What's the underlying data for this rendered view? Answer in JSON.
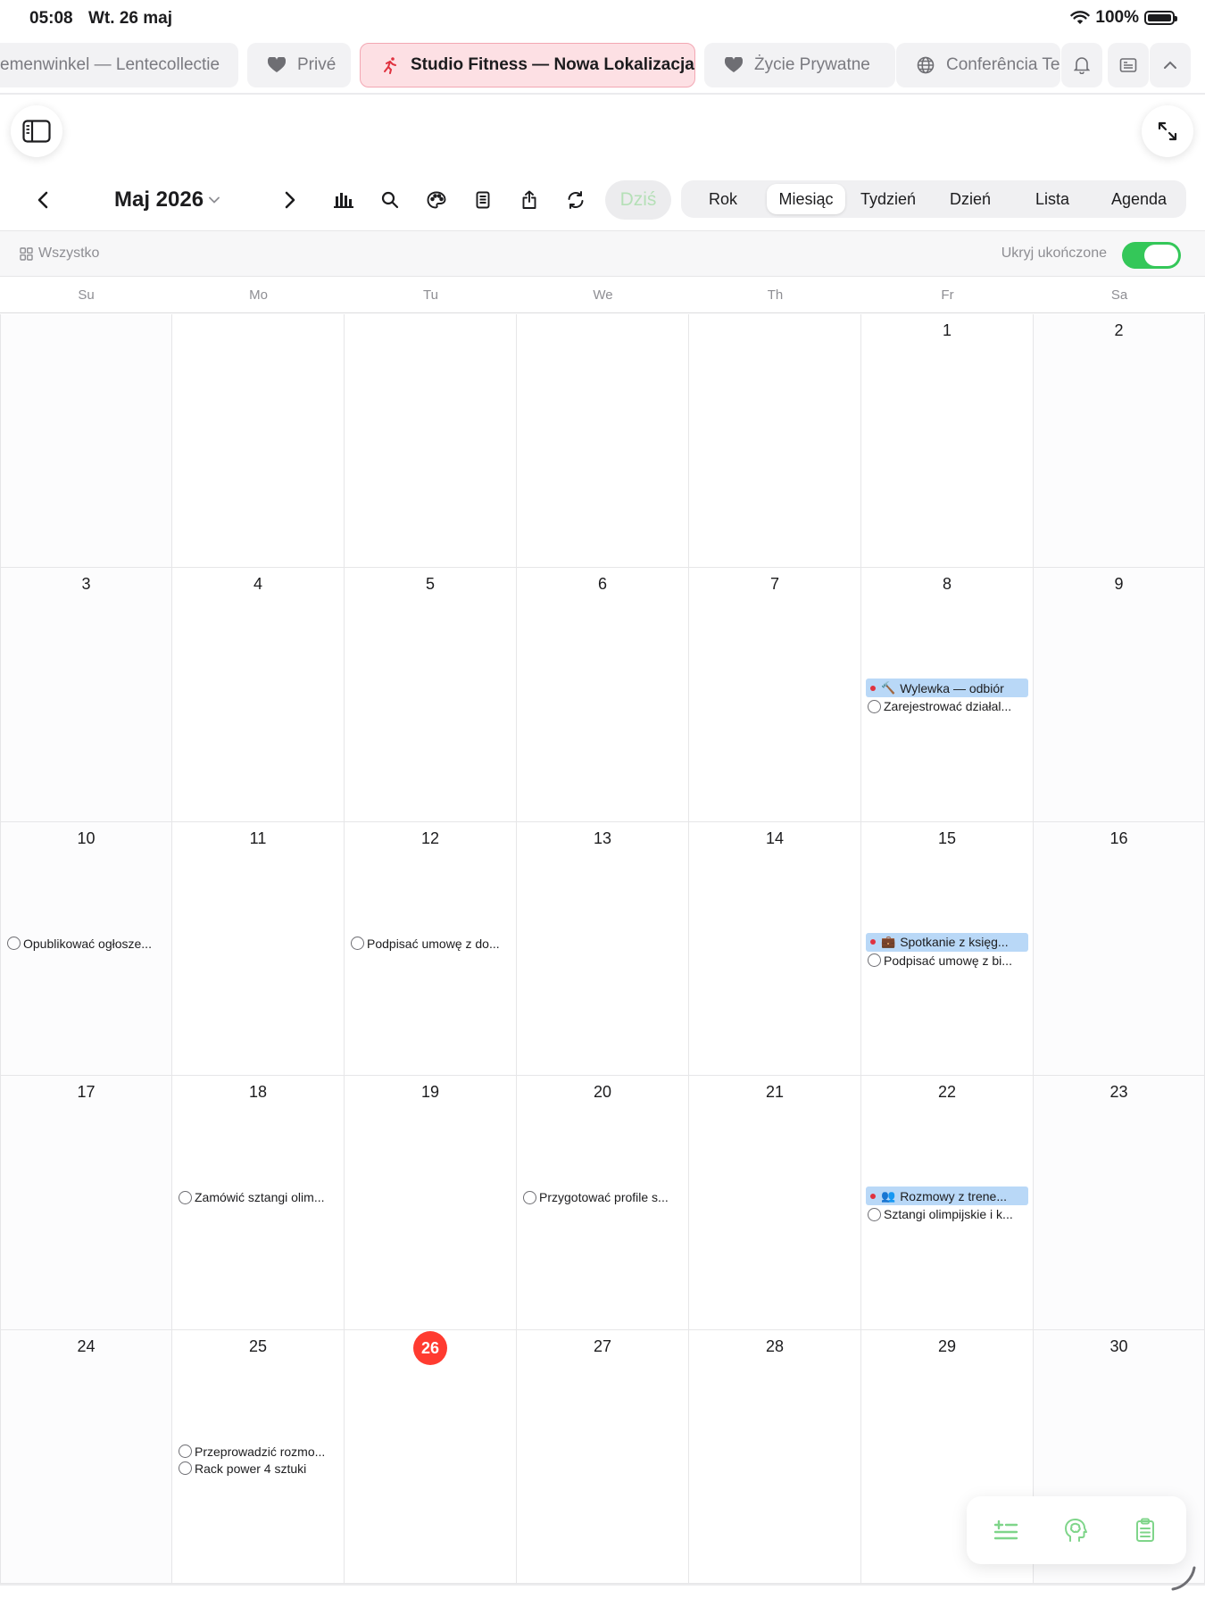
{
  "status": {
    "time": "05:08",
    "date": "Wt. 26 maj",
    "battery": "100%"
  },
  "tabs": [
    {
      "label": "emenwinkel — Lentecollectie",
      "icon": "none"
    },
    {
      "label": "Privé",
      "icon": "heart-icon"
    },
    {
      "label": "Studio Fitness — Nowa Lokalizacja",
      "icon": "runner-icon",
      "active": true
    },
    {
      "label": "Życie Prywatne",
      "icon": "heart-icon"
    },
    {
      "label": "Conferência Te",
      "icon": "globe-icon"
    }
  ],
  "toolbar": {
    "month_title": "Maj 2026",
    "today_label": "Dziś",
    "views": [
      "Rok",
      "Miesiąc",
      "Tydzień",
      "Dzień",
      "Lista",
      "Agenda"
    ],
    "selected_view": "Miesiąc"
  },
  "filter": {
    "all_label": "Wszystko",
    "hide_completed_label": "Ukryj ukończone",
    "hide_completed_on": true
  },
  "weekdays": [
    "Su",
    "Mo",
    "Tu",
    "We",
    "Th",
    "Fr",
    "Sa"
  ],
  "weeks": [
    [
      {
        "day": ""
      },
      {
        "day": ""
      },
      {
        "day": ""
      },
      {
        "day": ""
      },
      {
        "day": ""
      },
      {
        "day": "1"
      },
      {
        "day": "2"
      }
    ],
    [
      {
        "day": "3"
      },
      {
        "day": "4"
      },
      {
        "day": "5"
      },
      {
        "day": "6"
      },
      {
        "day": "7"
      },
      {
        "day": "8",
        "items": [
          {
            "kind": "event",
            "emoji": "🔨",
            "text": "Wylewka — odbiór"
          },
          {
            "kind": "task",
            "text": "Zarejestrować działal..."
          }
        ]
      },
      {
        "day": "9"
      }
    ],
    [
      {
        "day": "10",
        "items": [
          {
            "kind": "task",
            "text": "Opublikować ogłosze..."
          }
        ]
      },
      {
        "day": "11"
      },
      {
        "day": "12",
        "items": [
          {
            "kind": "task",
            "text": "Podpisać umowę z do..."
          }
        ]
      },
      {
        "day": "13"
      },
      {
        "day": "14"
      },
      {
        "day": "15",
        "items": [
          {
            "kind": "event",
            "emoji": "💼",
            "text": "Spotkanie z księg..."
          },
          {
            "kind": "task",
            "text": "Podpisać umowę z bi..."
          }
        ]
      },
      {
        "day": "16"
      }
    ],
    [
      {
        "day": "17"
      },
      {
        "day": "18",
        "items": [
          {
            "kind": "task",
            "text": "Zamówić sztangi olim..."
          }
        ]
      },
      {
        "day": "19"
      },
      {
        "day": "20",
        "items": [
          {
            "kind": "task",
            "text": "Przygotować profile s..."
          }
        ]
      },
      {
        "day": "21"
      },
      {
        "day": "22",
        "items": [
          {
            "kind": "event",
            "emoji": "👥",
            "text": "Rozmowy z trene..."
          },
          {
            "kind": "task",
            "text": "Sztangi olimpijskie i k..."
          }
        ]
      },
      {
        "day": "23"
      }
    ],
    [
      {
        "day": "24"
      },
      {
        "day": "25",
        "items": [
          {
            "kind": "task",
            "text": "Przeprowadzić rozmo..."
          },
          {
            "kind": "task",
            "text": "Rack power 4 sztuki"
          }
        ]
      },
      {
        "day": "26",
        "today": true
      },
      {
        "day": "27"
      },
      {
        "day": "28"
      },
      {
        "day": "29"
      },
      {
        "day": "30"
      }
    ]
  ],
  "colors": {
    "accent_green": "#34c759",
    "today_red": "#ff3b30",
    "event_blue": "#b9d8f7",
    "active_tab_pink": "#fde0e4"
  }
}
